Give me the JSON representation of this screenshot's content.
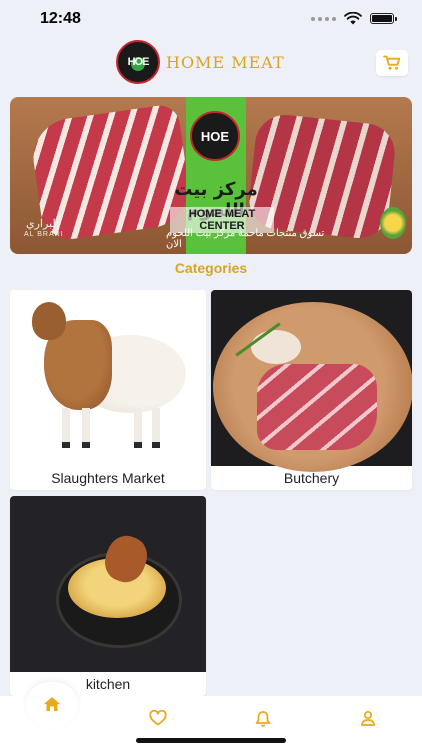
{
  "status_bar": {
    "time": "12:48"
  },
  "header": {
    "logo_text": "HOME MEAT",
    "logo_mark": "HOE"
  },
  "banner": {
    "arabic_title": "مركز بيت اللحوم",
    "english_title": "HOME MEAT CENTER",
    "arabic_subtitle": "تسوق منتجات ماحمة مركز بيت اللحوم الان",
    "watermark_ar": "البراري",
    "watermark_en": "AL BRARI"
  },
  "categories": {
    "title": "Categories",
    "items": [
      {
        "label": "Slaughters Market"
      },
      {
        "label": "Butchery"
      },
      {
        "label": "kitchen"
      }
    ]
  },
  "nav": {
    "items": [
      {
        "icon": "home-icon",
        "active": true
      },
      {
        "icon": "heart-icon",
        "active": false
      },
      {
        "icon": "bell-icon",
        "active": false
      },
      {
        "icon": "user-icon",
        "active": false
      }
    ]
  },
  "colors": {
    "accent": "#d9a520",
    "background": "#eef0f8",
    "card": "#ffffff",
    "text": "#222222"
  }
}
